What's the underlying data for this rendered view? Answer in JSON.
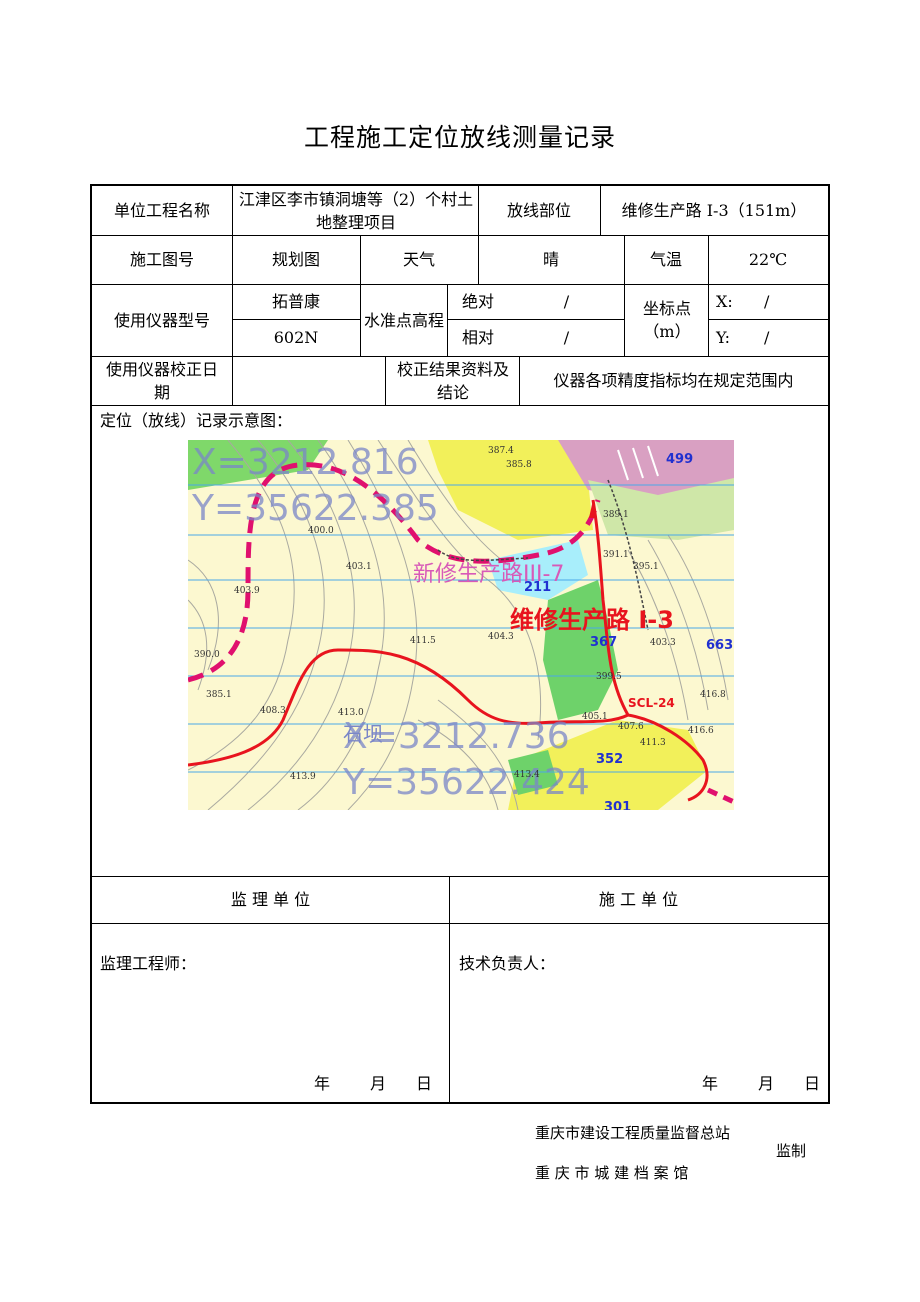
{
  "title": "工程施工定位放线测量记录",
  "row1": {
    "project_name_label": "单位工程名称",
    "project_name_value": "江津区李市镇洞塘等（2）个村土地整理项目",
    "location_label": "放线部位",
    "location_value": "维修生产路 I-3（151m）"
  },
  "row2": {
    "drawing_label": "施工图号",
    "drawing_value": "规划图",
    "weather_label": "天气",
    "weather_value": "晴",
    "temp_label": "气温",
    "temp_value": "22℃"
  },
  "row3": {
    "instrument_label": "使用仪器型号",
    "instrument_brand": "拓普康",
    "instrument_model": "602N",
    "benchmark_label": "水准点高程",
    "absolute_label": "绝对",
    "absolute_value": "/",
    "relative_label": "相对",
    "relative_value": "/",
    "coord_label": "坐标点（m）",
    "x_label": "X:",
    "x_value": "/",
    "y_label": "Y:",
    "y_value": "/"
  },
  "row4": {
    "calib_date_label": "使用仪器校正日 期",
    "calib_date_value": "",
    "calib_result_label": "校正结果资料及结论",
    "calib_result_value": "仪器各项精度指标均在规定范围内"
  },
  "sketch": {
    "label": "定位（放线）记录示意图：",
    "map": {
      "road_main": "维修生产路 I-3",
      "road_new": "新修生产路III-7",
      "coord_top_x": "X=3212.816",
      "coord_top_y": "Y=35622.385",
      "coord_bottom_x": "X=3212.736",
      "coord_bottom_y": "Y=35622.424",
      "place_name": "石坝",
      "point_label": "SCL-24",
      "parcels": [
        "499",
        "211",
        "367",
        "663",
        "352",
        "301"
      ],
      "elevations": [
        "387.4",
        "385.8",
        "389.1",
        "391.1",
        "395.1",
        "400.0",
        "403.1",
        "403.9",
        "404.3",
        "411.5",
        "390.0",
        "385.1",
        "403.3",
        "408.3",
        "413.0",
        "413.9",
        "405.1",
        "407.6",
        "411.3",
        "413.4",
        "416.8",
        "416.6",
        "399.5"
      ],
      "colors": {
        "road_main": "#e8141e",
        "road_new": "#e0106e",
        "water": "#a8eefb",
        "green": "#6ed26a",
        "yellow": "#f4f263",
        "pink": "#e0a8c0"
      }
    }
  },
  "supervision": {
    "unit_label": "监 理 单 位",
    "signer_label": "监理工程师：",
    "date_year": "年",
    "date_month": "月",
    "date_day": "日"
  },
  "construction": {
    "unit_label": "施 工 单 位",
    "signer_label": "技术负责人：",
    "date_year": "年",
    "date_month": "月",
    "date_day": "日"
  },
  "footer": {
    "line1": "重庆市建设工程质量监督总站",
    "line2": "监制",
    "line3": "重 庆 市 城 建 档 案 馆"
  }
}
